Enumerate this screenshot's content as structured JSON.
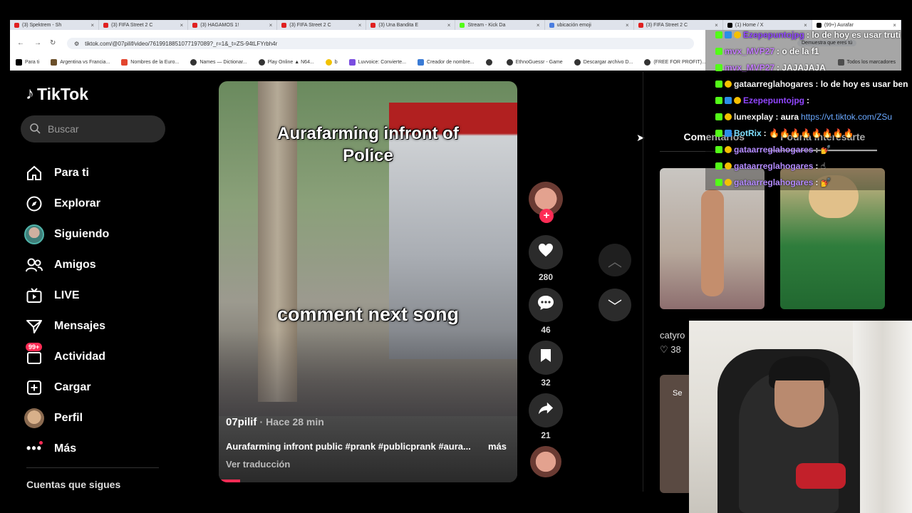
{
  "browser": {
    "tabs": [
      {
        "label": "(3) Spektrem - Sh"
      },
      {
        "label": "(3) FIFA Street 2 C"
      },
      {
        "label": "(3) HAGAMOS 1!"
      },
      {
        "label": "(3) FIFA Street 2 C"
      },
      {
        "label": "(3) Una Bandita E"
      },
      {
        "label": "Stream - Kick Da"
      },
      {
        "label": "ubicación emoji"
      },
      {
        "label": "(3) FIFA Street 2 C"
      },
      {
        "label": "(1) Home / X"
      },
      {
        "label": "(99+) Aurafar"
      }
    ],
    "url": "tiktok.com/@07pilif/video/7619918851077197089?_r=1&_t=ZS-94tLFYrbh4r",
    "extension_hint": "Demuestra que eres tú",
    "bookmarks": [
      {
        "label": "Para ti"
      },
      {
        "label": "Argentina vs Francia..."
      },
      {
        "label": "Nombres de la Euro..."
      },
      {
        "label": "Names — Dictionar..."
      },
      {
        "label": "Play Online ▲ N64..."
      },
      {
        "label": "b"
      },
      {
        "label": "Luvvoice: Convierte..."
      },
      {
        "label": "Creador de nombre..."
      },
      {
        "label": ""
      },
      {
        "label": "EthnoGuessr - Game"
      },
      {
        "label": "Descargar archivo D..."
      },
      {
        "label": "(FREE FOR PROFIT)..."
      }
    ],
    "bookmarks_all": "Todos los marcadores"
  },
  "sidebar": {
    "logo": "TikTok",
    "search_placeholder": "Buscar",
    "items": [
      {
        "label": "Para ti",
        "icon": "home-icon"
      },
      {
        "label": "Explorar",
        "icon": "compass-icon"
      },
      {
        "label": "Siguiendo",
        "icon": "avatar"
      },
      {
        "label": "Amigos",
        "icon": "friends-icon"
      },
      {
        "label": "LIVE",
        "icon": "live-icon"
      },
      {
        "label": "Mensajes",
        "icon": "message-icon"
      },
      {
        "label": "Actividad",
        "icon": "inbox-icon",
        "badge": "99+"
      },
      {
        "label": "Cargar",
        "icon": "upload-icon"
      },
      {
        "label": "Perfil",
        "icon": "avatar"
      },
      {
        "label": "Más",
        "icon": "more-icon"
      }
    ],
    "following_title": "Cuentas que sigues"
  },
  "video": {
    "overlay_title": "Aurafarming infront of Police",
    "overlay_caption": "comment next song",
    "author": "07pilif",
    "time": "· Hace 28 min",
    "description": "Aurafarming infront public #prank #publicprank #aura...",
    "more": "más",
    "translate": "Ver traducción"
  },
  "actions": {
    "likes": "280",
    "comments": "46",
    "saves": "32",
    "shares": "21"
  },
  "right_panel": {
    "tab_comments": "Comentarios",
    "tab_suggested": "Podría interesarte",
    "user": "catyro",
    "likes": "38",
    "thumb3_text": "Se"
  },
  "chat": {
    "messages": [
      {
        "user": "Ezepepuntojpg",
        "text": ": lo de hoy es usar truti"
      },
      {
        "user": "mvx_MVP27",
        "text": ": o de la f1"
      },
      {
        "user": "mvx_MVP27",
        "text": ": JAJAJAJA"
      },
      {
        "user": "gataarreglahogares",
        "text": ": lo de hoy es usar ben"
      },
      {
        "user": "Ezepepuntojpg",
        "text": ":"
      },
      {
        "user": "lunexplay",
        "text": ": aura",
        "link": "https://vt.tiktok.com/ZSu"
      },
      {
        "user": "BotRix",
        "text": ": 🔥🔥🔥🔥🔥🔥🔥🔥"
      },
      {
        "user": "gataarreglahogares",
        "text": ": 💅"
      },
      {
        "user": "gataarreglahogares",
        "text": ": ☝"
      },
      {
        "user": "gataarreglahogares",
        "text": ": 💅"
      }
    ]
  },
  "colors": {
    "accent": "#fe2c55",
    "kick_green": "#53fc18",
    "background": "#000000"
  }
}
